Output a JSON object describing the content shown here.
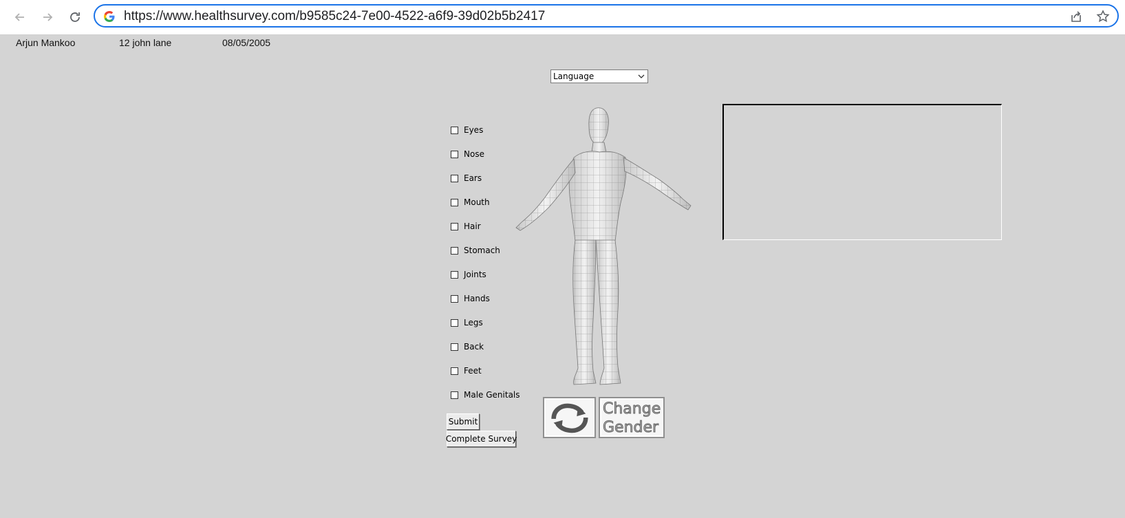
{
  "browser": {
    "url": "https://www.healthsurvey.com/b9585c24-7e00-4522-a6f9-39d02b5b2417",
    "back_icon": "back-arrow-icon",
    "forward_icon": "forward-arrow-icon",
    "reload_icon": "reload-icon",
    "share_icon": "share-icon",
    "star_icon": "bookmark-star-icon"
  },
  "patient": {
    "name": "Arjun Mankoo",
    "address": "12 john lane",
    "dob": "08/05/2005"
  },
  "language_select": {
    "value": "Language"
  },
  "body_parts": [
    {
      "label": "Eyes",
      "checked": false
    },
    {
      "label": "Nose",
      "checked": false
    },
    {
      "label": "Ears",
      "checked": false
    },
    {
      "label": "Mouth",
      "checked": false
    },
    {
      "label": "Hair",
      "checked": false
    },
    {
      "label": "Stomach",
      "checked": false
    },
    {
      "label": "Joints",
      "checked": false
    },
    {
      "label": "Hands",
      "checked": false
    },
    {
      "label": "Legs",
      "checked": false
    },
    {
      "label": "Back",
      "checked": false
    },
    {
      "label": "Feet",
      "checked": false
    },
    {
      "label": "Male Genitals",
      "checked": false
    }
  ],
  "buttons": {
    "submit": "Submit",
    "complete_survey": "Complete Survey",
    "change_gender_line1": "Change",
    "change_gender_line2": "Gender"
  },
  "colors": {
    "background": "#d4d4d4",
    "address_border": "#1a73e8"
  }
}
